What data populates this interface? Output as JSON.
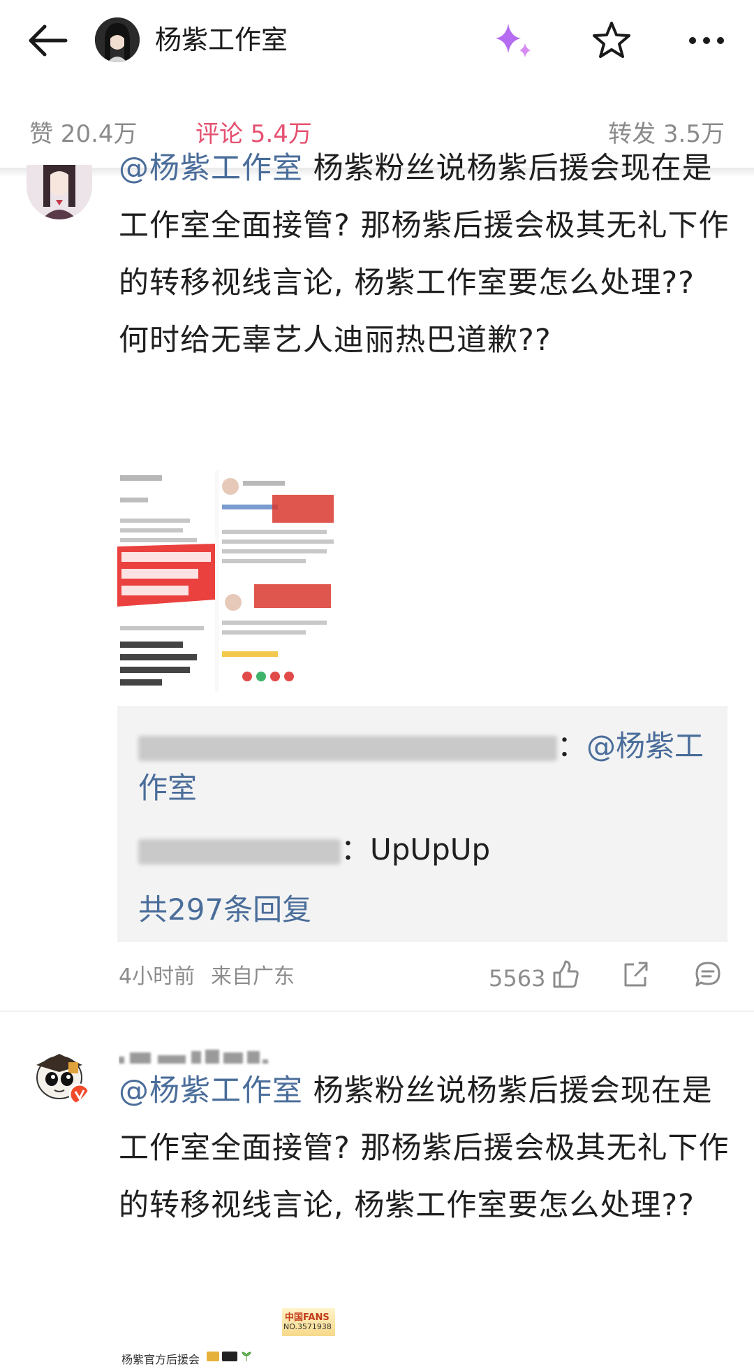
{
  "header": {
    "title": "杨紫工作室"
  },
  "stats": {
    "likes": "赞 20.4万",
    "comments": "评论 5.4万",
    "reposts": "转发 3.5万"
  },
  "comment1": {
    "mention": "@杨紫工作室",
    "text": " 杨紫粉丝说杨紫后援会现在是工作室全面接管? 那杨紫后援会极其无礼下作的转移视线言论, 杨紫工作室要怎么处理??  何时给无辜艺人迪丽热巴道歉??",
    "replies": {
      "reply1_suffix": "：",
      "reply1_mention": "@杨紫工作室",
      "reply2_suffix": "：UpUpUp",
      "count_label": "共297条回复"
    },
    "time": "4小时前",
    "location": "来自广东",
    "like_count": "5563"
  },
  "comment2": {
    "mention": "@杨紫工作室",
    "text": " 杨紫粉丝说杨紫后援会现在是工作室全面接管? 那杨紫后援会极其无礼下作的转移视线言论, 杨紫工作室要怎么处理??"
  },
  "thumbnail2": {
    "badge_line1": "中国FANS",
    "badge_line2": "NO.3571938",
    "caption": "杨紫官方后援会"
  },
  "colors": {
    "accent": "#e5506f",
    "link": "#4a6d9a",
    "meta": "#8c8c8c",
    "sparkle": "#b56cf0"
  }
}
